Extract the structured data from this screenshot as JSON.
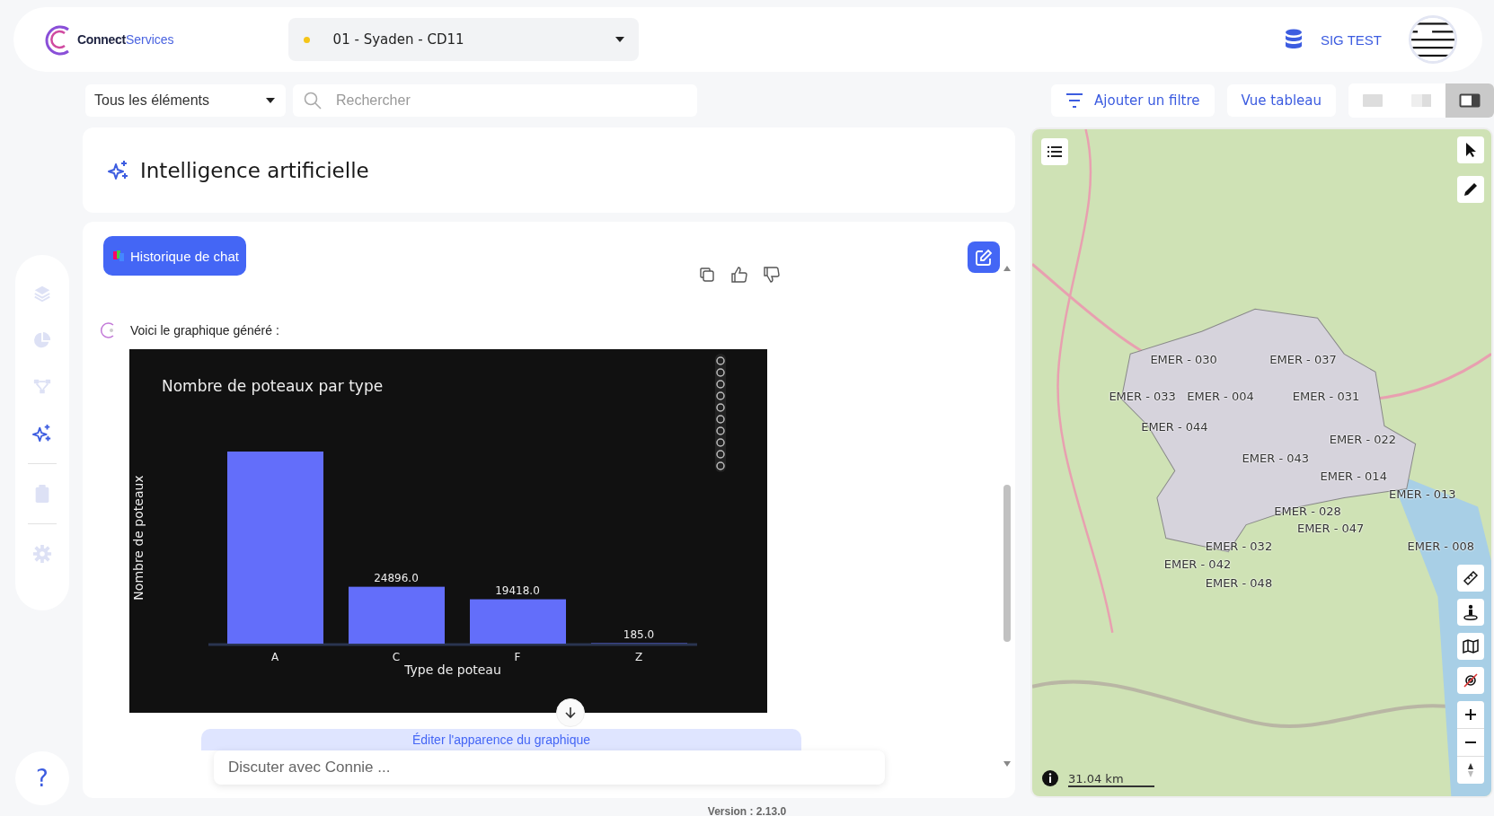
{
  "header": {
    "logo": {
      "brand_bold": "Connect",
      "brand_light": "Services"
    },
    "project_selector": {
      "value": "01 - Syaden - CD11"
    },
    "user": "SIG TEST"
  },
  "toolbar": {
    "type_filter": {
      "value": "Tous les éléments"
    },
    "search": {
      "placeholder": "Rechercher"
    },
    "add_filter": "Ajouter un filtre",
    "table_view": "Vue tableau",
    "view_modes": [
      {
        "kind": "full",
        "selected": false
      },
      {
        "kind": "split",
        "selected": false
      },
      {
        "kind": "panel",
        "selected": true
      }
    ]
  },
  "sidebar": {
    "items": [
      {
        "kind": "layers",
        "selected": false
      },
      {
        "kind": "chart",
        "selected": false
      },
      {
        "kind": "network",
        "selected": false
      },
      {
        "kind": "ai",
        "selected": true
      },
      {
        "kind": "clipboard",
        "selected": false
      },
      {
        "kind": "settings",
        "selected": false
      }
    ],
    "help": "?"
  },
  "ai_panel": {
    "title": "Intelligence artificielle"
  },
  "chat": {
    "history_button": "Historique de chat",
    "messages": [
      {
        "text": "Voici le graphique généré :",
        "chart_data": {
          "type": "bar",
          "title": "Nombre de poteaux par type",
          "xlabel": "Type de poteau",
          "ylabel": "Nombre de poteaux",
          "categories": [
            "A",
            "C",
            "F",
            "Z"
          ],
          "values": [
            84066,
            24896,
            19418,
            185
          ],
          "value_labels": [
            null,
            "24896.0",
            "19418.0",
            "185.0"
          ]
        }
      }
    ],
    "edit_chart_button": "Éditer l'apparence du graphique",
    "input": {
      "placeholder": "Discuter avec Connie ..."
    }
  },
  "map": {
    "region_labels": [
      "EMER - 030",
      "EMER - 037",
      "EMER - 033",
      "EMER - 004",
      "EMER - 031",
      "EMER - 044",
      "EMER - 022",
      "EMER - 043",
      "EMER - 014",
      "EMER - 013",
      "EMER - 028",
      "EMER - 047",
      "EMER - 032",
      "EMER - 008",
      "EMER - 042",
      "EMER - 048"
    ],
    "scale": "31.04 km"
  },
  "footer": {
    "version": "Version : 2.13.0"
  }
}
